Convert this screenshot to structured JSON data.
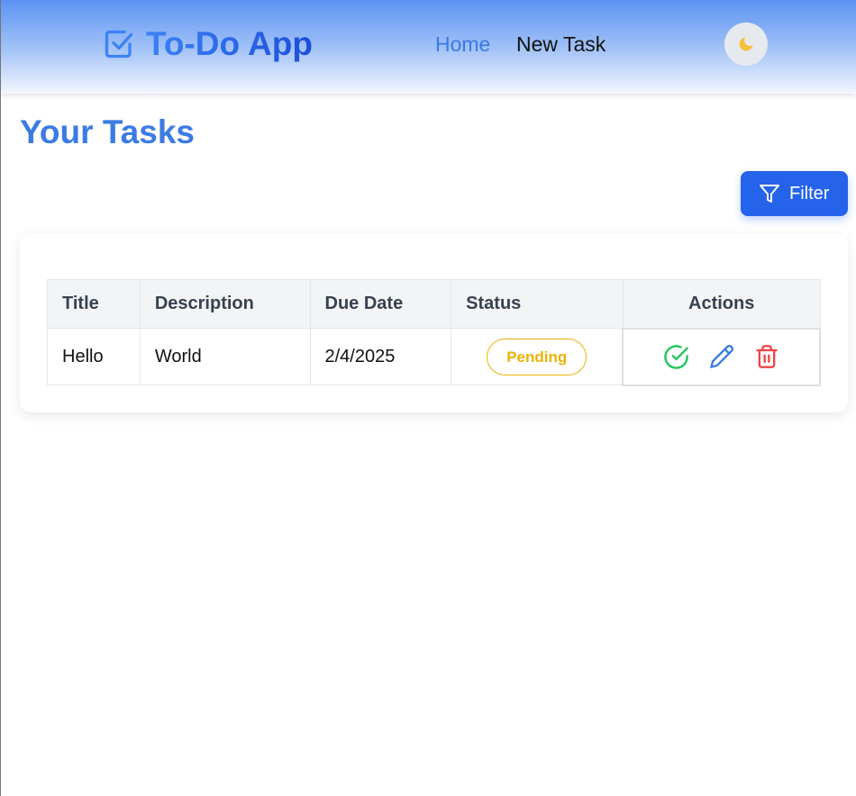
{
  "header": {
    "brand_icon": "checkbox-icon",
    "brand_text": "To-Do App",
    "nav": [
      {
        "label": "Home",
        "active": true,
        "color": "#3b7be3"
      },
      {
        "label": "New Task",
        "active": false,
        "color": "#111111"
      }
    ],
    "theme_toggle_icon": "moon-icon"
  },
  "page_title": "Your Tasks",
  "filter_button": {
    "label": "Filter",
    "icon": "filter-icon"
  },
  "table": {
    "columns": [
      "Title",
      "Description",
      "Due Date",
      "Status",
      "Actions"
    ],
    "rows": [
      {
        "title": "Hello",
        "description": "World",
        "due_date": "2/4/2025",
        "status": "Pending",
        "actions": [
          "complete-icon",
          "edit-icon",
          "delete-icon"
        ]
      }
    ]
  },
  "colors": {
    "primary": "#2563eb",
    "title": "#3b7be3",
    "pending": "#eab308",
    "complete": "#22c55e",
    "edit": "#3b7be3",
    "delete": "#ef4444"
  }
}
